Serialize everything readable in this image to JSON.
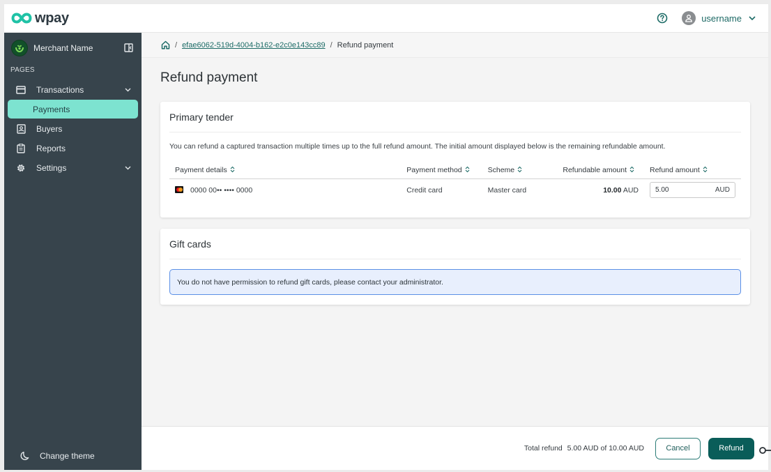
{
  "header": {
    "logo_text": "wpay",
    "help_icon": "question-circle-icon",
    "user_icon": "user-avatar-icon",
    "username": "username"
  },
  "sidebar": {
    "merchant_name": "Merchant Name",
    "section_label": "PAGES",
    "items": [
      {
        "label": "Transactions",
        "icon": "credit-card-icon",
        "expandable": true,
        "active": false
      },
      {
        "label": "Payments",
        "icon": "",
        "sub": true,
        "active": true
      },
      {
        "label": "Buyers",
        "icon": "contact-card-icon",
        "active": false
      },
      {
        "label": "Reports",
        "icon": "clipboard-icon",
        "active": false
      },
      {
        "label": "Settings",
        "icon": "gear-icon",
        "expandable": true,
        "active": false
      }
    ],
    "change_theme": "Change theme",
    "active_color": "#7de3d0"
  },
  "breadcrumb": {
    "home_icon": "home-icon",
    "separator": "/",
    "transaction_id": "efae6062-519d-4004-b162-e2c0e143cc89",
    "current": "Refund payment"
  },
  "page": {
    "title": "Refund payment"
  },
  "primary_tender": {
    "title": "Primary tender",
    "description": "You can refund a captured transaction multiple times up to the full refund amount. The initial amount displayed below is the remaining refundable amount.",
    "columns": [
      "Payment details",
      "Payment method",
      "Scheme",
      "Refundable amount",
      "Refund amount"
    ],
    "rows": [
      {
        "card_icon": "mastercard-icon",
        "card_number": "0000 00•• •••• 0000",
        "method": "Credit card",
        "scheme": "Master card",
        "refundable_value": "10.00",
        "refundable_currency": "AUD",
        "refund_value": "5.00",
        "refund_currency": "AUD"
      }
    ]
  },
  "gift_cards": {
    "title": "Gift cards",
    "alert": "You do not have permission to refund gift cards, please contact your administrator."
  },
  "footer": {
    "total_label": "Total refund",
    "total_value": "5.00 AUD of 10.00 AUD",
    "cancel_label": "Cancel",
    "refund_label": "Refund"
  },
  "colors": {
    "brand_teal": "#0a5d59",
    "link": "#1c6b66",
    "sidebar_bg": "#37444c",
    "alert_border": "#5a8fe6",
    "alert_bg": "#e8effd"
  }
}
